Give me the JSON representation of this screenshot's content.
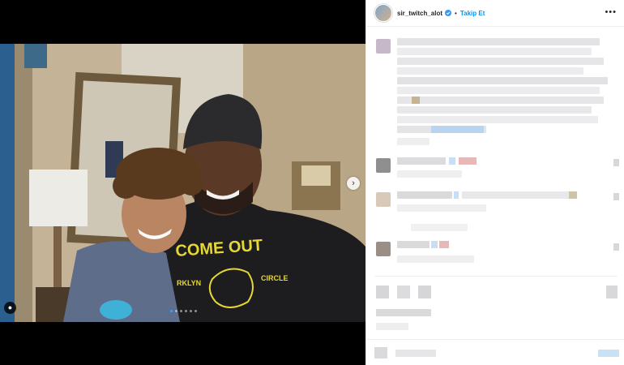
{
  "post_header": {
    "username": "sir_twitch_alot",
    "follow_label": "Takip Et",
    "more_label": "•••"
  },
  "photo": {
    "shirt_text_line1": "COME OUT",
    "shirt_text_line2": "RKLYN",
    "shirt_text_line3": "CIRCLE",
    "carousel_next_label": "›",
    "tag_icon_label": "●",
    "carousel_index": 1,
    "carousel_total": 6
  },
  "colors": {
    "accent": "#0095f6",
    "verified": "#3897f0"
  }
}
